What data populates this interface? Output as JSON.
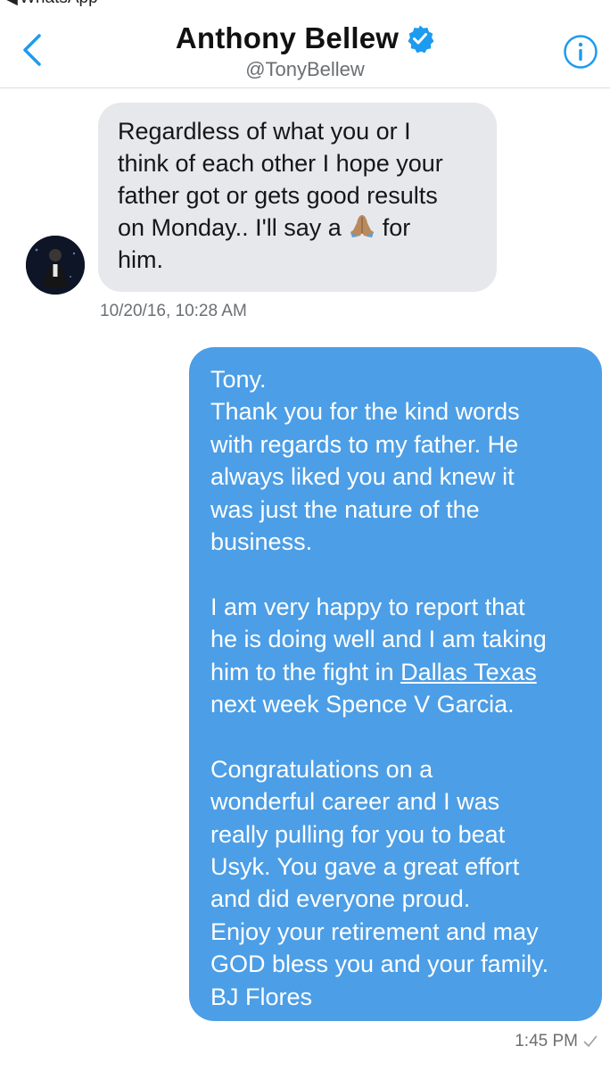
{
  "status_bar": {
    "back_app_label": "WhatsApp"
  },
  "header": {
    "title": "Anthony Bellew",
    "handle": "@TonyBellew",
    "verified": true,
    "accent_color": "#1d9bf0"
  },
  "conversation": {
    "incoming": {
      "lines": [
        "Regardless of what you or I",
        "think of each other I hope your",
        "father got or gets good results",
        "on Monday.. I'll say a",
        "for",
        "him."
      ],
      "emoji": "folded-hands-emoji",
      "timestamp": "10/20/16, 10:28 AM"
    },
    "outgoing": {
      "paragraphs": [
        "Tony.",
        "Thank you for the kind words",
        "with regards to my father.  He",
        "always liked you and knew it",
        "was just the nature of the",
        "business.",
        "I am very happy to report that",
        "he is doing well and I am taking",
        "him to the fight in",
        "Dallas Texas",
        "next week Spence V Garcia.",
        "Congratulations on a",
        "wonderful career and I was",
        "really pulling for you to beat",
        "Usyk. You gave a great effort",
        "and did everyone proud.",
        "Enjoy your retirement and may",
        "GOD bless you and your family.",
        "BJ Flores"
      ],
      "timestamp": "1:45 PM",
      "bubble_color": "#4c9ee6"
    }
  }
}
